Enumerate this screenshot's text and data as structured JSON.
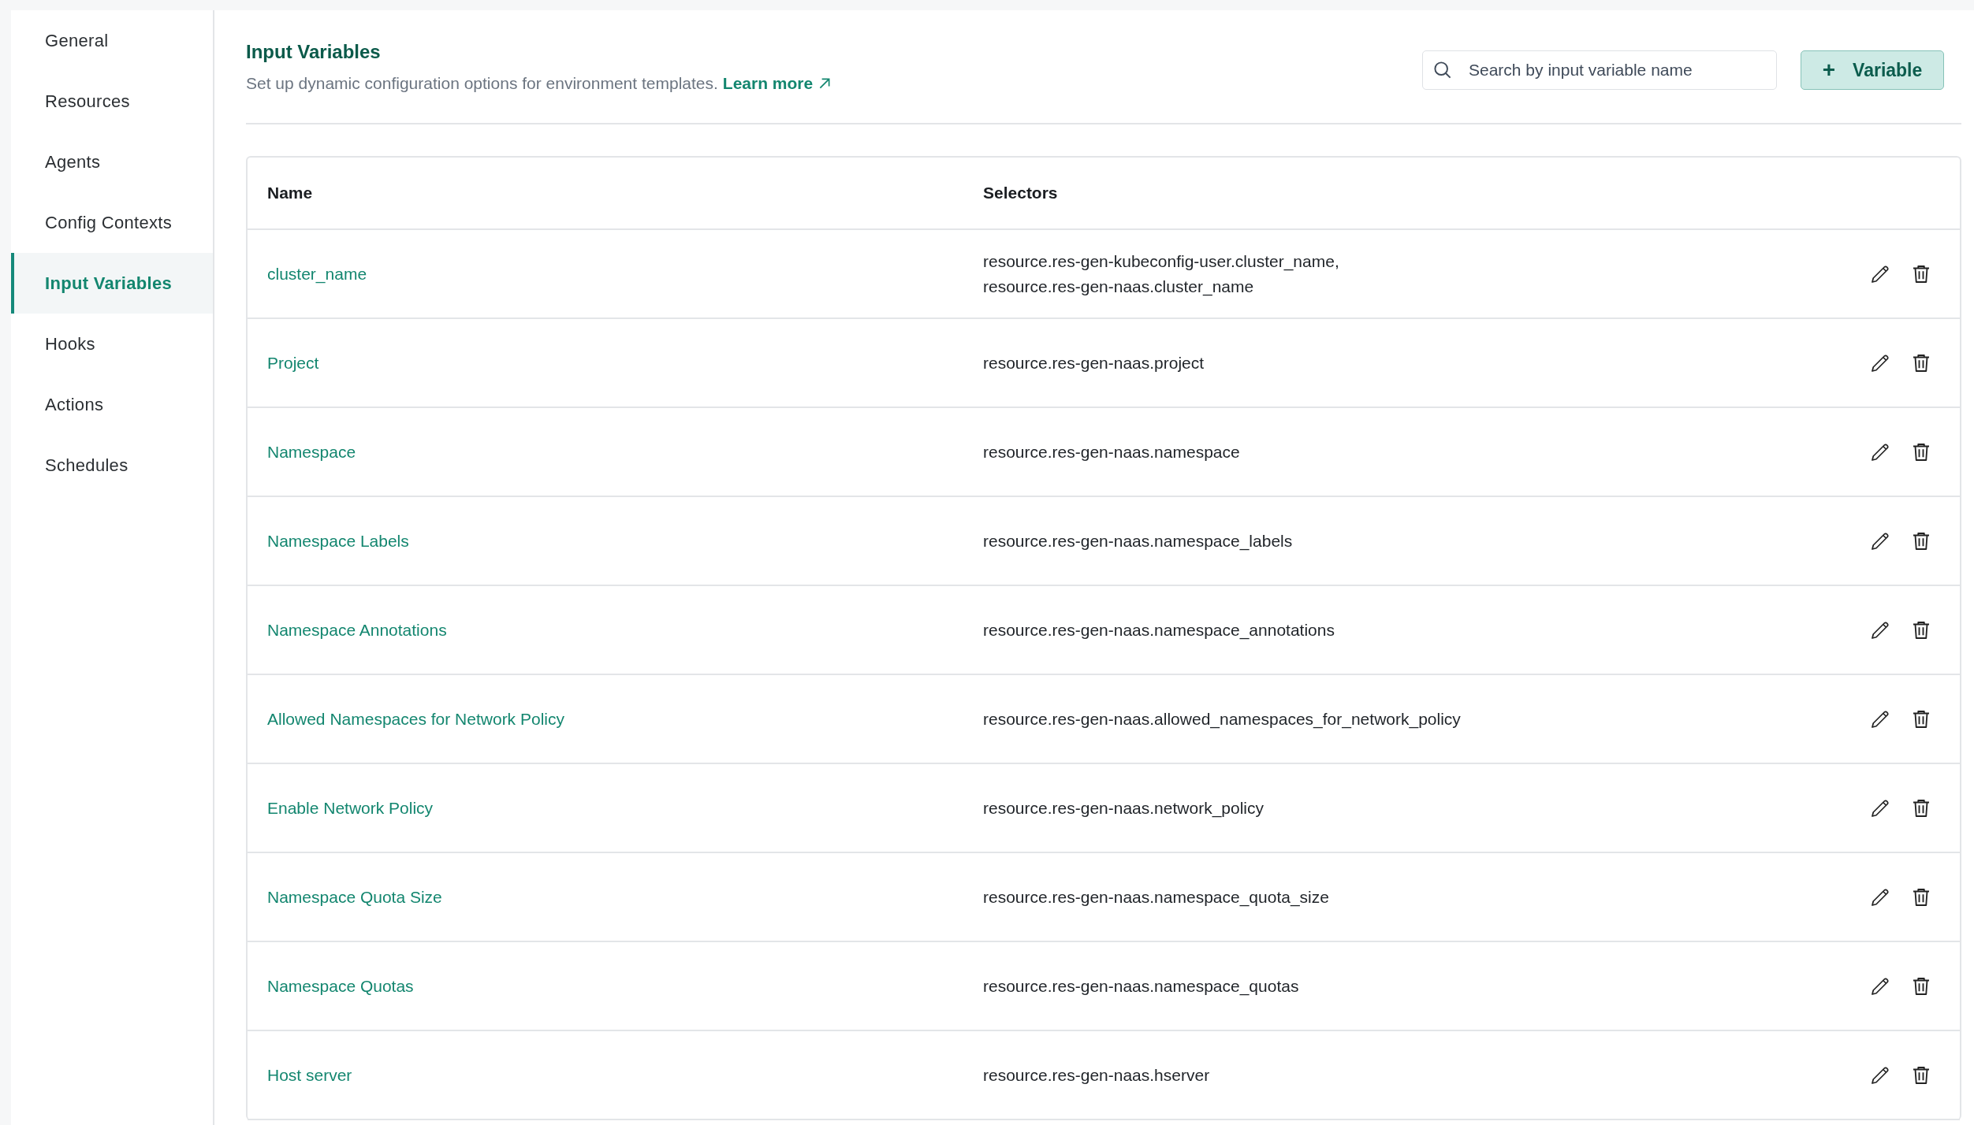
{
  "sidebar": {
    "items": [
      {
        "label": "General",
        "selected": false
      },
      {
        "label": "Resources",
        "selected": false
      },
      {
        "label": "Agents",
        "selected": false
      },
      {
        "label": "Config Contexts",
        "selected": false
      },
      {
        "label": "Input Variables",
        "selected": true
      },
      {
        "label": "Hooks",
        "selected": false
      },
      {
        "label": "Actions",
        "selected": false
      },
      {
        "label": "Schedules",
        "selected": false
      }
    ]
  },
  "header": {
    "title": "Input Variables",
    "description": "Set up dynamic configuration options for environment templates.",
    "link": "Learn more"
  },
  "search": {
    "placeholder": "Search by input variable name"
  },
  "add_button": {
    "icon": "+",
    "label": "Variable"
  },
  "table": {
    "columns": [
      "Name",
      "Selectors"
    ],
    "rows": [
      {
        "name": "cluster_name",
        "selectors": [
          "resource.res-gen-kubeconfig-user.cluster_name,",
          "resource.res-gen-naas.cluster_name"
        ]
      },
      {
        "name": "Project",
        "selectors": [
          "resource.res-gen-naas.project"
        ]
      },
      {
        "name": "Namespace",
        "selectors": [
          "resource.res-gen-naas.namespace"
        ]
      },
      {
        "name": "Namespace Labels",
        "selectors": [
          "resource.res-gen-naas.namespace_labels"
        ]
      },
      {
        "name": "Namespace Annotations",
        "selectors": [
          "resource.res-gen-naas.namespace_annotations"
        ]
      },
      {
        "name": "Allowed Namespaces for Network Policy",
        "selectors": [
          "resource.res-gen-naas.allowed_namespaces_for_network_policy"
        ]
      },
      {
        "name": "Enable Network Policy",
        "selectors": [
          "resource.res-gen-naas.network_policy"
        ]
      },
      {
        "name": "Namespace Quota Size",
        "selectors": [
          "resource.res-gen-naas.namespace_quota_size"
        ]
      },
      {
        "name": "Namespace Quotas",
        "selectors": [
          "resource.res-gen-naas.namespace_quotas"
        ]
      },
      {
        "name": "Host server",
        "selectors": [
          "resource.res-gen-naas.hserver"
        ]
      }
    ]
  }
}
